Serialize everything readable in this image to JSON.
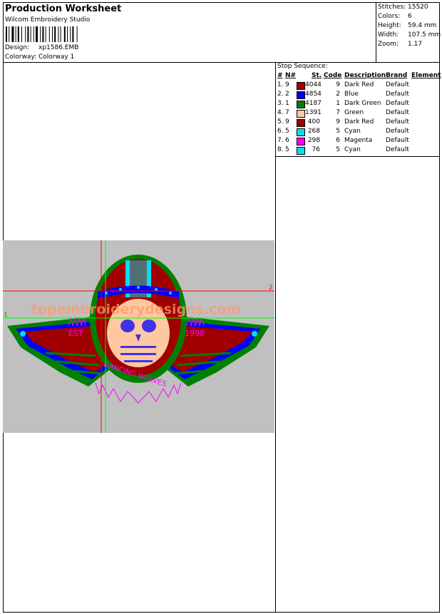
{
  "header": {
    "title": "Production Worksheet",
    "software": "Wilcom Embroidery Studio",
    "design_label": "Design:",
    "design_value": "xp1586.EMB",
    "colorway_label": "Colorway:",
    "colorway_value": "Colorway 1"
  },
  "stats": [
    {
      "label": "Stitches:",
      "value": "15520"
    },
    {
      "label": "Colors:",
      "value": "6"
    },
    {
      "label": "Height:",
      "value": "59.4 mm"
    },
    {
      "label": "Width:",
      "value": "107.5 mm"
    },
    {
      "label": "Zoom:",
      "value": "1.17"
    }
  ],
  "stop_sequence": {
    "title": "Stop Sequence:",
    "columns": [
      "#",
      "N#",
      "St.",
      "Code",
      "Description",
      "Brand",
      "Element"
    ],
    "rows": [
      {
        "num": "1.",
        "n": "9",
        "color": "#a00000",
        "st": "4044",
        "code": "9",
        "desc": "Dark Red",
        "brand": "Default"
      },
      {
        "num": "2.",
        "n": "2",
        "color": "#0000ff",
        "st": "4854",
        "code": "2",
        "desc": "Blue",
        "brand": "Default"
      },
      {
        "num": "3.",
        "n": "1",
        "color": "#008000",
        "st": "4187",
        "code": "1",
        "desc": "Dark Green",
        "brand": "Default"
      },
      {
        "num": "4.",
        "n": "7",
        "color": "#ffc8a0",
        "st": "1391",
        "code": "7",
        "desc": "Green",
        "brand": "Default"
      },
      {
        "num": "5.",
        "n": "9",
        "color": "#a00000",
        "st": "400",
        "code": "9",
        "desc": "Dark Red",
        "brand": "Default"
      },
      {
        "num": "6.",
        "n": "5",
        "color": "#00e0f0",
        "st": "268",
        "code": "5",
        "desc": "Cyan",
        "brand": "Default"
      },
      {
        "num": "7.",
        "n": "6",
        "color": "#ff00ff",
        "st": "298",
        "code": "6",
        "desc": "Magenta",
        "brand": "Default"
      },
      {
        "num": "8.",
        "n": "5",
        "color": "#00e0f0",
        "st": "76",
        "code": "5",
        "desc": "Cyan",
        "brand": "Default"
      }
    ]
  },
  "design_preview": {
    "watermark": "topembroiderydesigns.com",
    "left_text": "EST",
    "right_text": "1998",
    "arc_text": "DANCING WOLVES",
    "guide_marker_1": "1",
    "guide_marker_2": "2",
    "colors": {
      "background": "#c0c0c0",
      "dark_red": "#a00000",
      "blue": "#0000ff",
      "green": "#008000",
      "skin": "#ffc8a0",
      "cyan": "#00e0f0",
      "magenta": "#ff00ff"
    }
  }
}
